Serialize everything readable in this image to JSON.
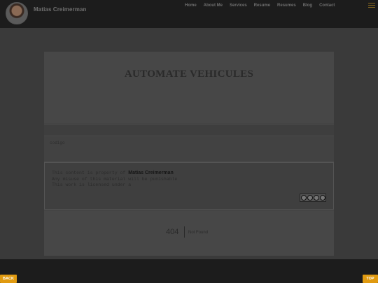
{
  "header": {
    "brand": "Matias Creimerman",
    "nav": [
      "Home",
      "About Me",
      "Services",
      "Resume",
      "Resumes",
      "Blog",
      "Contact"
    ]
  },
  "hero": {
    "title": "AUTOMATE VEHICULES"
  },
  "breadcrumb": "",
  "content": {
    "text": "codigo"
  },
  "license": {
    "line1_prefix": "This content is property of",
    "author": "Matias Creimerman",
    "line2": "Any misuse of this material will be punishable",
    "line3_prefix": "This work is licensed under a",
    "license_link": "",
    "badge": "cc by nc sa"
  },
  "notfound": {
    "code": "404",
    "text": "Not Found"
  },
  "footer": {
    "back": "BACK",
    "top": "TOP"
  },
  "colors": {
    "accent": "#e09a10",
    "header_bg": "#1c1c1c",
    "page_bg": "#3a3a3a"
  }
}
